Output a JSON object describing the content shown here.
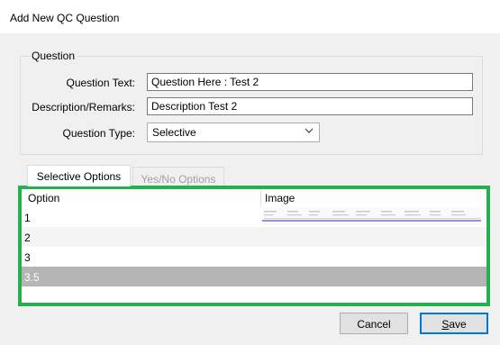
{
  "window": {
    "title": "Add New QC Question"
  },
  "question_group": {
    "legend": "Question",
    "question_text_label": "Question Text:",
    "question_text_value": "Question Here : Test 2",
    "description_label": "Description/Remarks:",
    "description_value": "Description Test 2",
    "type_label": "Question Type:",
    "type_value": "Selective"
  },
  "tabs": [
    {
      "label": "Selective Options",
      "active": true
    },
    {
      "label": "Yes/No Options",
      "active": false
    }
  ],
  "grid": {
    "columns": [
      "Option",
      "Image"
    ],
    "rows": [
      {
        "option": "1",
        "has_image": true,
        "state": "normal"
      },
      {
        "option": "2",
        "has_image": false,
        "state": "alternate"
      },
      {
        "option": "3",
        "has_image": false,
        "state": "normal"
      },
      {
        "option": "3.5",
        "has_image": false,
        "state": "selected"
      }
    ],
    "highlight_color": "#22b14c"
  },
  "buttons": {
    "cancel": "Cancel",
    "save_rest": "ave",
    "save_mnemonic": "S"
  },
  "icons": {
    "dropdown": "chevron-down-icon",
    "image": "image-thumbnail"
  }
}
